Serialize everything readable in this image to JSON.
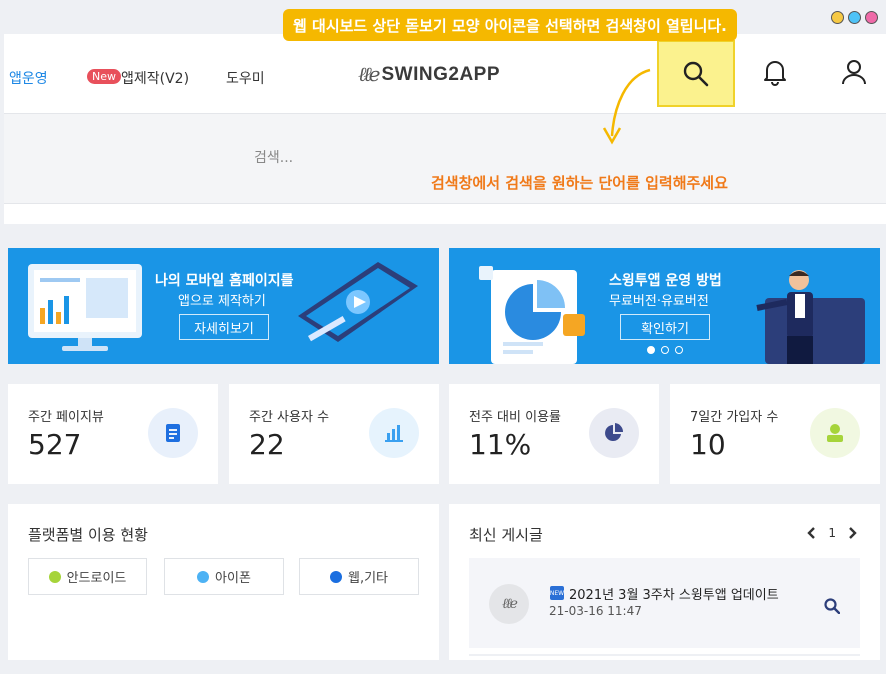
{
  "tooltip": "웹 대시보드 상단 돋보기 모양 아이콘을 선택하면 검색창이 열립니다.",
  "nav": {
    "app_manage": "앱운영",
    "new_badge": "New",
    "app_make": "앱제작(V2)",
    "help": "도우미"
  },
  "logo": {
    "mark": "ℓℓe",
    "text": "SWING2APP"
  },
  "search": {
    "placeholder": "검색...",
    "hint": "검색창에서 검색을 원하는 단어를 입력해주세요"
  },
  "banners": [
    {
      "title": "나의 모바일 홈페이지를",
      "subtitle": "앱으로 제작하기",
      "button": "자세히보기"
    },
    {
      "title": "스윙투앱 운영 방법",
      "subtitle": "무료버전·유료버전",
      "button": "확인하기"
    }
  ],
  "stats": [
    {
      "label": "주간 페이지뷰",
      "value": "527",
      "icon": "document-icon",
      "color": "#1e6fe0",
      "bg": "#e8f0fb"
    },
    {
      "label": "주간 사용자 수",
      "value": "22",
      "icon": "bar-chart-icon",
      "color": "#3aa0f0",
      "bg": "#e6f3fd"
    },
    {
      "label": "전주 대비 이용률",
      "value": "11%",
      "icon": "pie-chart-icon",
      "color": "#3d4a8c",
      "bg": "#e9ebf3"
    },
    {
      "label": "7일간 가입자 수",
      "value": "10",
      "icon": "user-icon",
      "color": "#a6d43a",
      "bg": "#f1f8e1"
    }
  ],
  "platform": {
    "title": "플랫폼별 이용 현황",
    "legend": [
      {
        "label": "안드로이드",
        "color": "#a6d43a"
      },
      {
        "label": "아이폰",
        "color": "#4db2f4"
      },
      {
        "label": "웹,기타",
        "color": "#1a6ee0"
      }
    ]
  },
  "posts": {
    "title": "최신 게시글",
    "page": "1",
    "items": [
      {
        "badge": "NEW",
        "title": "2021년 3월 3주차 스윙투앱 업데이트",
        "date": "21-03-16 11:47"
      }
    ]
  }
}
